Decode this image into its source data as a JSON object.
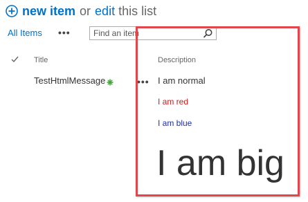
{
  "command_bar": {
    "new_item_label": "new item",
    "or_text": "or",
    "edit_label": "edit",
    "rest_text": "this list"
  },
  "view": {
    "all_items_label": "All Items",
    "more_label": "•••",
    "search_placeholder": "Find an item"
  },
  "list": {
    "headers": {
      "title": "Title",
      "description": "Description"
    },
    "rows": [
      {
        "title": "TestHtmlMessage",
        "more_label": "•••",
        "description": {
          "normal": "I am normal",
          "red": "I am red",
          "blue": "I am blue",
          "big": "I am big"
        }
      }
    ]
  },
  "colors": {
    "link_blue": "#0072c6",
    "red_text": "#cc1b1b",
    "blue_text": "#1b2fb0",
    "highlight_border": "#e0464b",
    "new_badge_green": "#3fa535"
  },
  "icons": {
    "new_item": "plus-circle-icon",
    "search": "search-icon",
    "check": "checkmark-icon",
    "new_badge": "new-badge-icon"
  }
}
